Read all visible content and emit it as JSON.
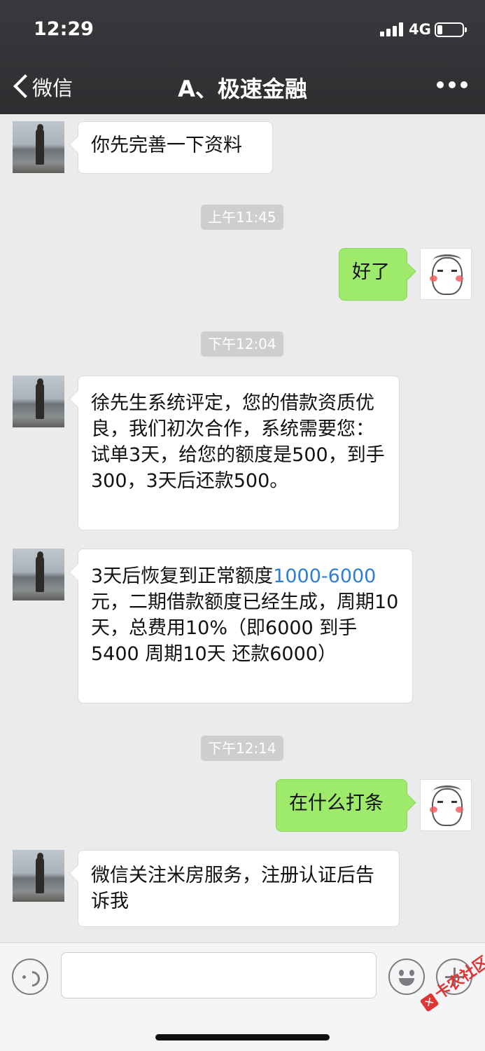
{
  "status_bar": {
    "time": "12:29",
    "network": "4G"
  },
  "header": {
    "back_label": "微信",
    "title": "A、极速金融"
  },
  "messages": {
    "m1": "你先完善一下资料",
    "t1": "上午11:45",
    "m2": "好了",
    "t2": "下午12:04",
    "m3": "徐先生系统评定，您的借款资质优良，我们初次合作，系统需要您：试单3天，给您的额度是500，到手300，3天后还款500。",
    "m4_prefix": "3天后恢复到正常额度",
    "m4_link": "1000-6000",
    "m4_suffix": "元，二期借款额度已经生成，周期10天，总费用10%（即6000   到手 5400  周期10天 还款6000）",
    "t3": "下午12:14",
    "m5": "在什么打条",
    "m6": "微信关注米房服务，注册认证后告诉我"
  },
  "input": {
    "value": "",
    "placeholder": ""
  },
  "watermark": {
    "text": "卡农社区"
  },
  "colors": {
    "outgoing_bubble": "#9eea6a",
    "link": "#2f7fd1",
    "header": "#333336"
  }
}
